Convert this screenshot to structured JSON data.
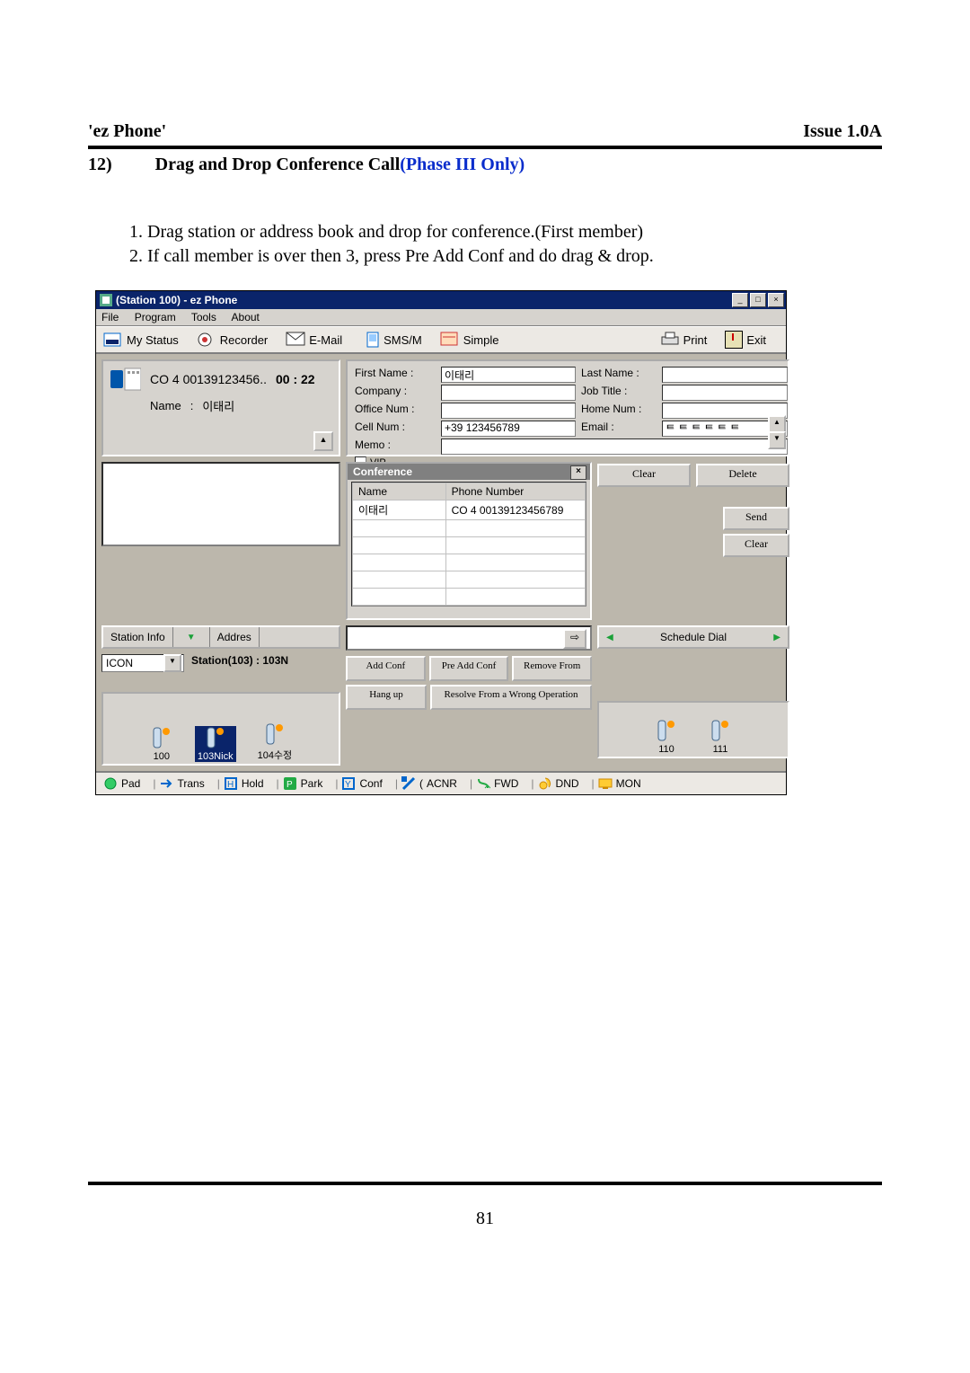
{
  "doc": {
    "product_name": "'ez Phone'",
    "issue": "Issue 1.0A",
    "section_num": "12)",
    "section_title": "Drag and Drop Conference Call",
    "section_accent": "(Phase III Only)",
    "steps": [
      "Drag station or address book and drop for conference.(First member)",
      "If call member is over then 3, press Pre Add Conf and do drag & drop."
    ],
    "page_number": "81"
  },
  "win": {
    "title": "(Station 100) - ez Phone",
    "menu": [
      "File",
      "Program",
      "Tools",
      "About"
    ],
    "toolbar": {
      "my_status": "My Status",
      "recorder": "Recorder",
      "email": "E-Mail",
      "smsm": "SMS/M",
      "simple": "Simple",
      "print": "Print",
      "exit": "Exit"
    }
  },
  "call": {
    "line1_prefix": "CO  4 00139123456..",
    "timer": "00 : 22",
    "name_label": "Name",
    "name_value": "이태리"
  },
  "contact": {
    "first_name_label": "First Name  :",
    "first_name_value": "이태리",
    "last_name_label": "Last Name  :",
    "company_label": "Company   :",
    "job_title_label": "Job Title    :",
    "office_num_label": "Office Num :",
    "home_num_label": "Home Num :",
    "cell_num_label": "Cell Num   :",
    "cell_num_value": "+39 123456789",
    "email_label": "Email        :",
    "email_value": "ᄐ ᄐ ᄐ ᄐ ᄐ ᄐ",
    "memo_label": "Memo        :",
    "vip_label": "VIP"
  },
  "conf": {
    "title": "Conference",
    "col_name": "Name",
    "col_phone": "Phone Number",
    "rows": [
      {
        "name": "이태리",
        "phone": "CO  4 00139123456789"
      }
    ]
  },
  "cmd": {
    "clear": "Clear",
    "delete": "Delete",
    "send": "Send",
    "clear2": "Clear"
  },
  "station_info": {
    "tab_station": "Station Info",
    "tab_address": "Addres",
    "combo_value": "ICON",
    "status": "Station(103) :  103N",
    "icons": [
      {
        "label": "100"
      },
      {
        "label": "103Nick",
        "selected": true
      },
      {
        "label": "104수정"
      }
    ]
  },
  "schedule": {
    "title": "Schedule Dial",
    "icons": [
      {
        "label": "110"
      },
      {
        "label": "111"
      }
    ]
  },
  "conf_buttons": {
    "add_conf": "Add Conf",
    "pre_add_conf": "Pre Add Conf",
    "remove_from": "Remove From",
    "hang_up": "Hang up",
    "resolve": "Resolve From a Wrong Operation"
  },
  "statusbar": {
    "pad": "Pad",
    "trans": "Trans",
    "hold": "Hold",
    "park": "Park",
    "conf": "Conf",
    "acnr": "ACNR",
    "fwd": "FWD",
    "dnd": "DND",
    "mon": "MON"
  }
}
